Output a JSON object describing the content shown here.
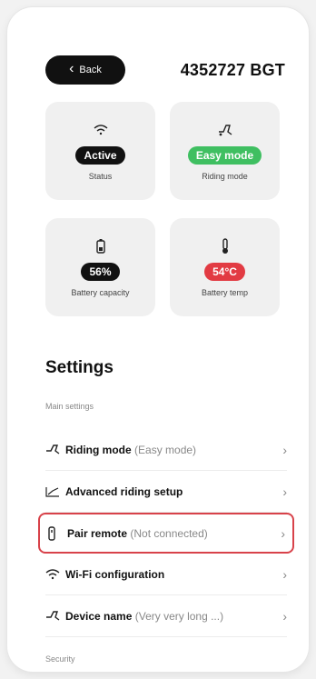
{
  "header": {
    "back_label": "Back",
    "device_id": "4352727 BGT"
  },
  "stats": [
    {
      "icon": "wifi-icon",
      "value": "Active",
      "label": "Status",
      "color": "black"
    },
    {
      "icon": "scooter-icon",
      "value": "Easy mode",
      "label": "Riding mode",
      "color": "green"
    },
    {
      "icon": "battery-icon",
      "value": "56%",
      "label": "Battery capacity",
      "color": "black"
    },
    {
      "icon": "thermometer-icon",
      "value": "54°C",
      "label": "Battery temp",
      "color": "red"
    }
  ],
  "settings": {
    "title": "Settings",
    "section_main": "Main settings",
    "items": [
      {
        "label": "Riding mode",
        "sub": "(Easy mode)",
        "icon": "scooter-icon"
      },
      {
        "label": "Advanced riding setup",
        "sub": "",
        "icon": "chart-icon"
      },
      {
        "label": "Pair remote",
        "sub": "(Not connected)",
        "icon": "remote-icon"
      },
      {
        "label": "Wi-Fi configuration",
        "sub": "",
        "icon": "wifi-icon"
      },
      {
        "label": "Device name",
        "sub": "(Very very long ...)",
        "icon": "scooter-icon"
      }
    ],
    "section_security": "Security"
  },
  "colors": {
    "accent_green": "#3fbf61",
    "accent_red": "#e23b43",
    "highlight_border": "#d8424a"
  }
}
